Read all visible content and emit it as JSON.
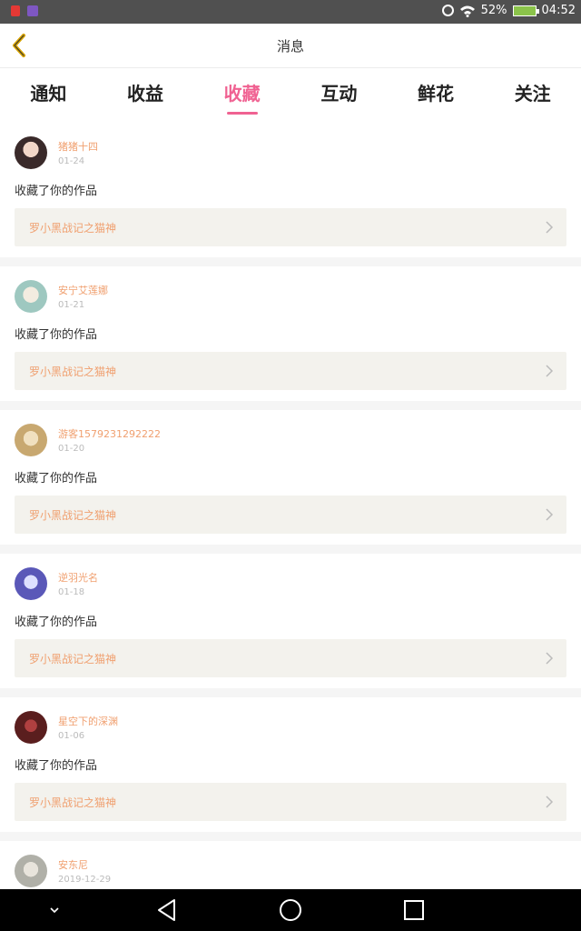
{
  "status_bar": {
    "battery": "52%",
    "time": "04:52"
  },
  "header": {
    "title": "消息"
  },
  "tabs": [
    {
      "label": "通知",
      "active": false
    },
    {
      "label": "收益",
      "active": false
    },
    {
      "label": "收藏",
      "active": true
    },
    {
      "label": "互动",
      "active": false
    },
    {
      "label": "鲜花",
      "active": false
    },
    {
      "label": "关注",
      "active": false
    }
  ],
  "items": [
    {
      "user": "猪猪十四",
      "date": "01-24",
      "action": "收藏了你的作品",
      "work": "罗小黑战记之猫神",
      "avatar_color": "#3a2a2a"
    },
    {
      "user": "安宁艾莲娜",
      "date": "01-21",
      "action": "收藏了你的作品",
      "work": "罗小黑战记之猫神",
      "avatar_color": "#9ec8c0"
    },
    {
      "user": "游客1579231292222",
      "date": "01-20",
      "action": "收藏了你的作品",
      "work": "罗小黑战记之猫神",
      "avatar_color": "#c8a870"
    },
    {
      "user": "逆羽光名",
      "date": "01-18",
      "action": "收藏了你的作品",
      "work": "罗小黑战记之猫神",
      "avatar_color": "#5a58b8"
    },
    {
      "user": "星空下的深渊",
      "date": "01-06",
      "action": "收藏了你的作品",
      "work": "罗小黑战记之猫神",
      "avatar_color": "#5a1e1e"
    },
    {
      "user": "安东尼",
      "date": "2019-12-29",
      "action": "",
      "work": "",
      "avatar_color": "#b0b0a8"
    }
  ],
  "colors": {
    "accent": "#f06292",
    "name": "#f0a070",
    "back": "#d8a400"
  }
}
